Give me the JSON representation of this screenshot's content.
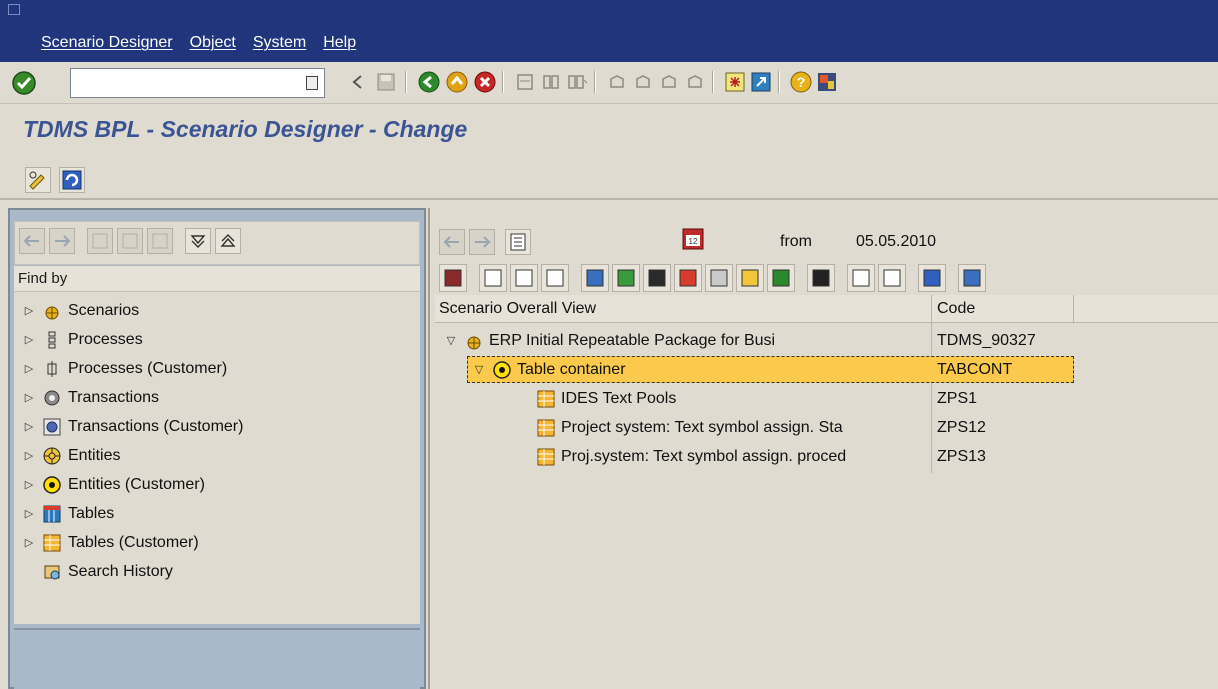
{
  "menubar": {
    "items": [
      {
        "label": "Scenario Designer"
      },
      {
        "label": "Object"
      },
      {
        "label": "System"
      },
      {
        "label": "Help"
      }
    ]
  },
  "command_field": {
    "value": "",
    "placeholder": ""
  },
  "title": "TDMS BPL - Scenario Designer - Change",
  "left_pane": {
    "find_by_label": "Find by",
    "items": [
      {
        "label": "Scenarios",
        "icon": "scenario-icon"
      },
      {
        "label": "Processes",
        "icon": "process-icon"
      },
      {
        "label": "Processes (Customer)",
        "icon": "process-customer-icon"
      },
      {
        "label": "Transactions",
        "icon": "transaction-icon"
      },
      {
        "label": "Transactions (Customer)",
        "icon": "transaction-customer-icon"
      },
      {
        "label": "Entities",
        "icon": "entity-icon"
      },
      {
        "label": "Entities (Customer)",
        "icon": "entity-customer-icon"
      },
      {
        "label": "Tables",
        "icon": "table-icon"
      },
      {
        "label": "Tables (Customer)",
        "icon": "table-customer-icon"
      },
      {
        "label": "Search History",
        "icon": "search-history-icon"
      }
    ]
  },
  "right_pane": {
    "from_label": "from",
    "from_date": "05.05.2010",
    "columns": {
      "overview": "Scenario Overall View",
      "code": "Code"
    },
    "rows": [
      {
        "name": "ERP Initial Repeatable Package for Busi",
        "code": "TDMS_90327",
        "level": 0,
        "icon": "scenario-icon",
        "expanded": true
      },
      {
        "name": "Table container",
        "code": "TABCONT",
        "level": 1,
        "icon": "entity-customer-icon",
        "expanded": true,
        "selected": true
      },
      {
        "name": "IDES Text Pools",
        "code": "ZPS1",
        "level": 2,
        "icon": "table-customer-icon"
      },
      {
        "name": "Project system: Text symbol assign. Sta",
        "code": "ZPS12",
        "level": 2,
        "icon": "table-customer-icon"
      },
      {
        "name": "Proj.system: Text symbol assign. proced",
        "code": "ZPS13",
        "level": 2,
        "icon": "table-customer-icon"
      }
    ]
  },
  "colors": {
    "menubar": "#21357c",
    "title": "#3b5594",
    "selection": "#fbc94b",
    "background": "#dfdbd0",
    "left_frame": "#a9b9c9"
  }
}
